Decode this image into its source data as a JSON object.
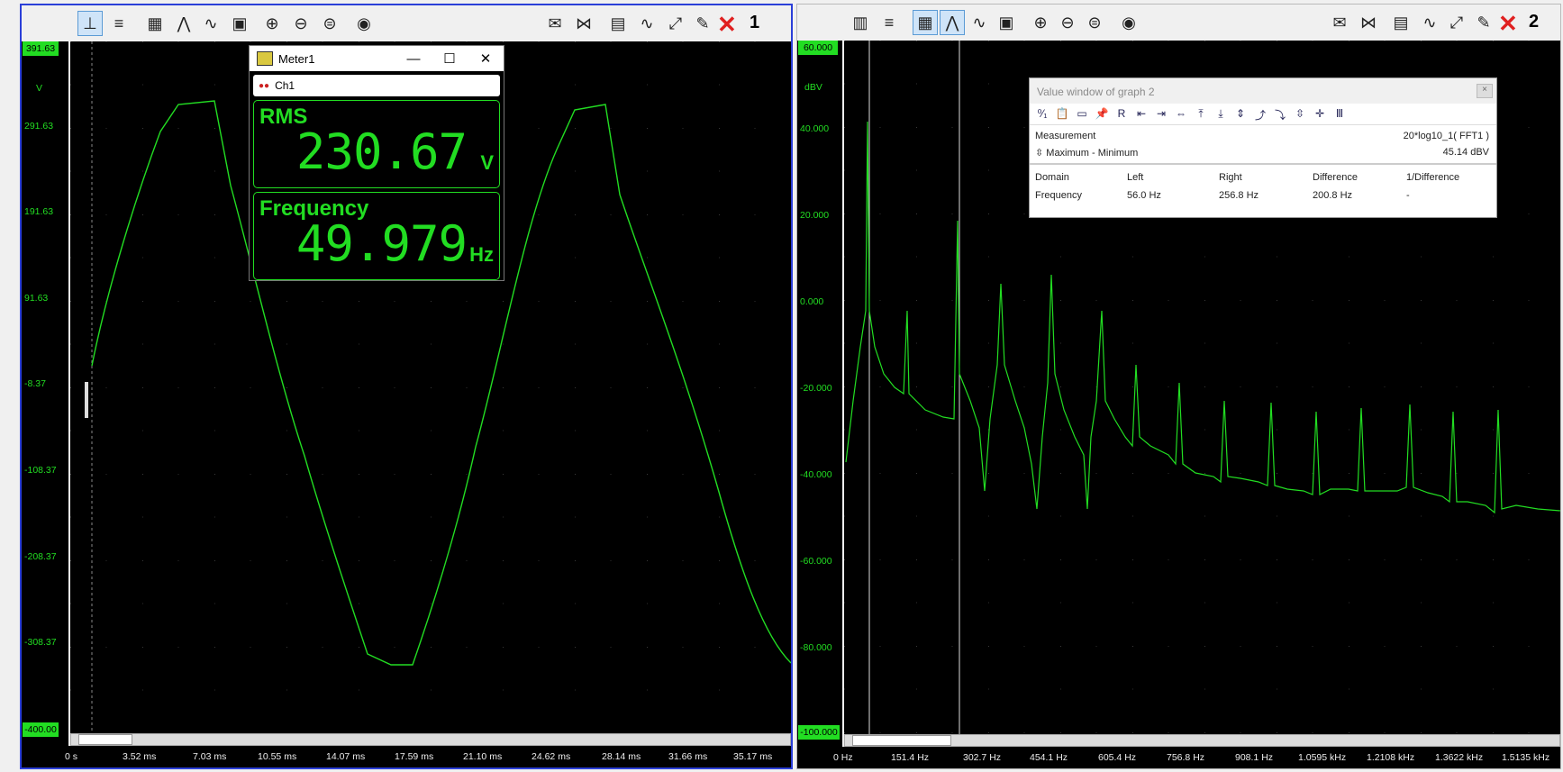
{
  "graph1": {
    "window_number": "1",
    "y_top": "391.63",
    "y_unit": "V",
    "y_labels": [
      "291.63",
      "191.63",
      "91.63",
      "-8.37",
      "-108.37",
      "-208.37",
      "-308.37"
    ],
    "y_bottom": "-400.00",
    "x_labels": [
      "0 s",
      "3.52 ms",
      "7.03 ms",
      "10.55 ms",
      "14.07 ms",
      "17.59 ms",
      "21.10 ms",
      "24.62 ms",
      "28.14 ms",
      "31.66 ms",
      "35.17 ms"
    ]
  },
  "meter": {
    "title": "Meter1",
    "channel": "Ch1",
    "rms_label": "RMS",
    "rms_value": "230.67",
    "rms_unit": "V",
    "freq_label": "Frequency",
    "freq_value": "49.979",
    "freq_unit": "Hz"
  },
  "graph2": {
    "window_number": "2",
    "y_top": "60.000",
    "y_unit": "dBV",
    "y_labels": [
      "40.000",
      "20.000",
      "0.000",
      "-20.000",
      "-40.000",
      "-60.000",
      "-80.000"
    ],
    "y_bottom": "-100.000",
    "x_labels": [
      "0 Hz",
      "151.4 Hz",
      "302.7 Hz",
      "454.1 Hz",
      "605.4 Hz",
      "756.8 Hz",
      "908.1 Hz",
      "1.0595 kHz",
      "1.2108 kHz",
      "1.3622 kHz",
      "1.5135 kHz"
    ]
  },
  "value_window": {
    "title": "Value window of graph 2",
    "measurement_label": "Measurement",
    "measurement_value": "20*log10_1( FFT1 )",
    "maxmin_label": "Maximum - Minimum",
    "maxmin_value": "45.14 dBV",
    "headers": [
      "Domain",
      "Left",
      "Right",
      "Difference",
      "1/Difference"
    ],
    "row": [
      "Frequency",
      "56.0 Hz",
      "256.8 Hz",
      "200.8 Hz",
      "-"
    ]
  },
  "colors": {
    "trace": "#22dd22",
    "background": "#000000",
    "frame_active": "#2b3fd8"
  }
}
